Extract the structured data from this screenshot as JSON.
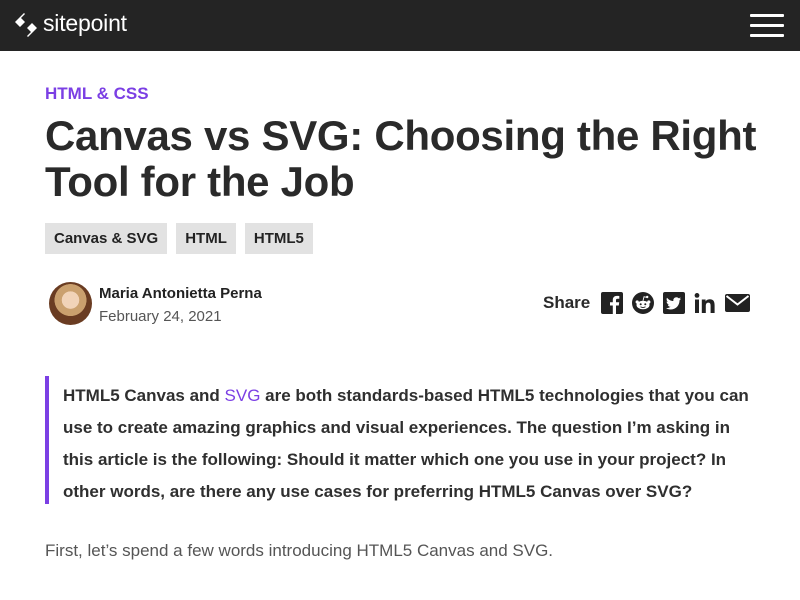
{
  "site": {
    "logo_text": "sitepoint",
    "menu_icon": "hamburger-menu-icon"
  },
  "article": {
    "category": "HTML & CSS",
    "title": "Canvas vs SVG: Choosing the Right Tool for the Job",
    "tags": [
      "Canvas & SVG",
      "HTML",
      "HTML5"
    ],
    "author": {
      "name": "Maria Antonietta Perna",
      "date": "February 24, 2021"
    },
    "share": {
      "label": "Share",
      "icons": [
        "facebook-icon",
        "reddit-icon",
        "twitter-icon",
        "linkedin-icon",
        "email-icon"
      ]
    },
    "lead": {
      "before_link": "HTML5 Canvas and ",
      "link_text": "SVG",
      "after_link": " are both standards-based HTML5 technologies that you can use to create amazing graphics and visual experiences. The question I’m asking in this article is the following: Should it matter which one you use in your project? In other words, are there any use cases for preferring HTML5 Canvas over SVG?"
    },
    "intro_paragraph": "First, let’s spend a few words introducing HTML5 Canvas and SVG."
  },
  "colors": {
    "topbar_bg": "#242424",
    "accent": "#7b3fe4",
    "tag_bg": "#e2e2e2"
  }
}
